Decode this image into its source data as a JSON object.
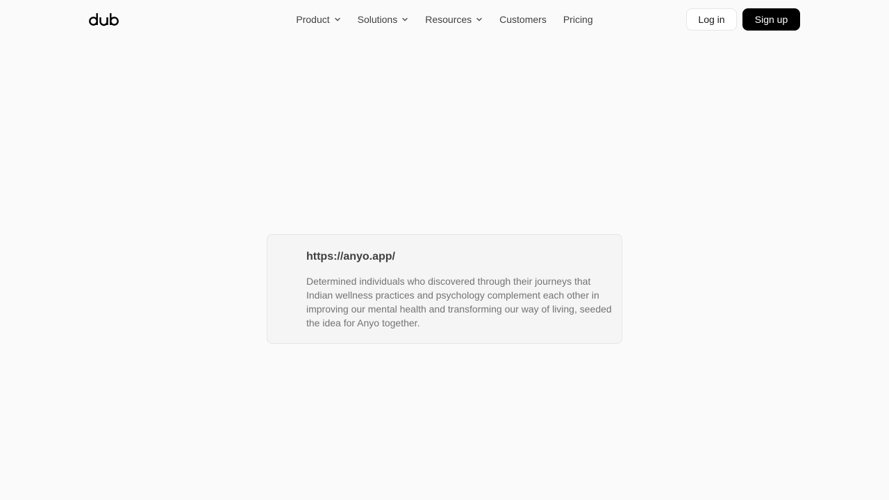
{
  "header": {
    "logo_text": "dub",
    "nav": [
      {
        "label": "Product",
        "has_dropdown": true
      },
      {
        "label": "Solutions",
        "has_dropdown": true
      },
      {
        "label": "Resources",
        "has_dropdown": true
      },
      {
        "label": "Customers",
        "has_dropdown": false
      },
      {
        "label": "Pricing",
        "has_dropdown": false
      }
    ],
    "login_label": "Log in",
    "signup_label": "Sign up"
  },
  "card": {
    "url": "https://anyo.app/",
    "description": "Determined individuals who discovered through their journeys that Indian wellness practices and psychology complement each other in improving our mental health and transforming our way of living, seeded the idea for Anyo together."
  },
  "colors": {
    "background": "#fafafa",
    "card_background": "#f5f5f5",
    "primary_button": "#000000"
  },
  "icons": {
    "logo": "dub-logo",
    "dropdown": "chevron-down-icon"
  }
}
